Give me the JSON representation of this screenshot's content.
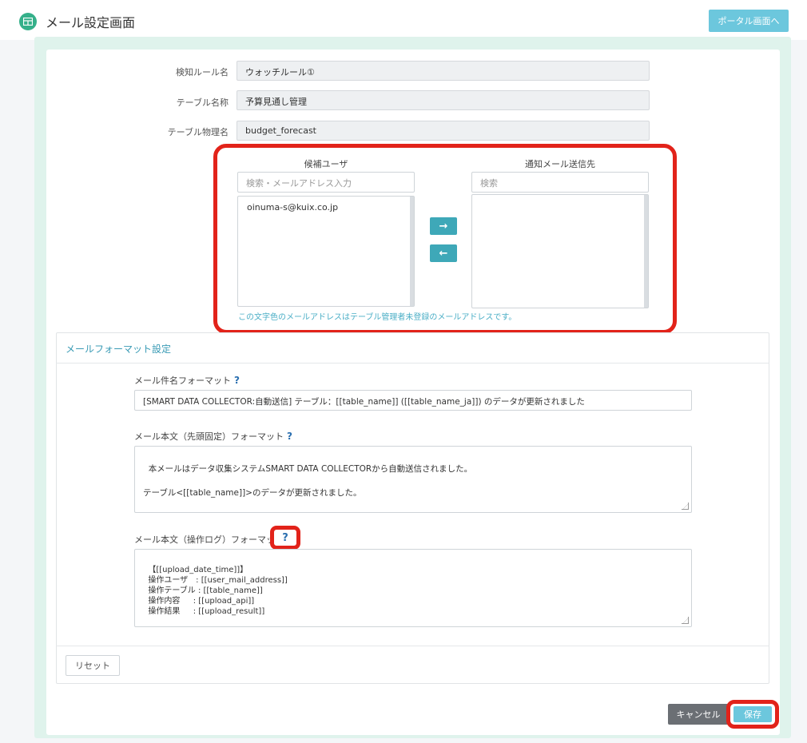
{
  "header": {
    "title": "メール設定画面",
    "portal_button": "ポータル画面へ"
  },
  "form": {
    "rule_name": {
      "label": "検知ルール名",
      "value": "ウォッチルール①"
    },
    "table_name": {
      "label": "テーブル名称",
      "value": "予算見通し管理"
    },
    "table_physical": {
      "label": "テーブル物理名",
      "value": "budget_forecast"
    }
  },
  "users": {
    "candidate": {
      "header": "候補ユーザ",
      "placeholder": "検索・メールアドレス入力",
      "items": [
        "oinuma-s@kuix.co.jp"
      ]
    },
    "recipients": {
      "header": "通知メール送信先",
      "placeholder": "検索",
      "items": []
    },
    "move_right_icon": "arrow-right",
    "move_left_icon": "arrow-left",
    "note": "この文字色のメールアドレスはテーブル管理者未登録のメールアドレスです。"
  },
  "format": {
    "title": "メールフォーマット設定",
    "subject_label": "メール件名フォーマット",
    "subject_value": "[SMART DATA COLLECTOR:自動送信] テーブル：[[table_name]] ([[table_name_ja]]) のデータが更新されました",
    "body_fixed_label": "メール本文（先頭固定）フォーマット",
    "body_fixed_value": "本メールはデータ収集システムSMART DATA COLLECTORから自動送信されました。\n\nテーブル<[[table_name]]>のデータが更新されました。",
    "body_log_label": "メール本文（操作ログ）フォーマット",
    "body_log_value": "【[[upload_date_time]]】\n  操作ユーザ　: [[user_mail_address]]\n  操作テーブル : [[table_name]]\n  操作内容　  : [[upload_api]]\n  操作結果　  : [[upload_result]]",
    "help": "?",
    "reset": "リセット"
  },
  "actions": {
    "cancel": "キャンセル",
    "save": "保存"
  },
  "colors": {
    "accent": "#6cc7dd",
    "highlight": "#e2231a",
    "note": "#4aaec6"
  }
}
